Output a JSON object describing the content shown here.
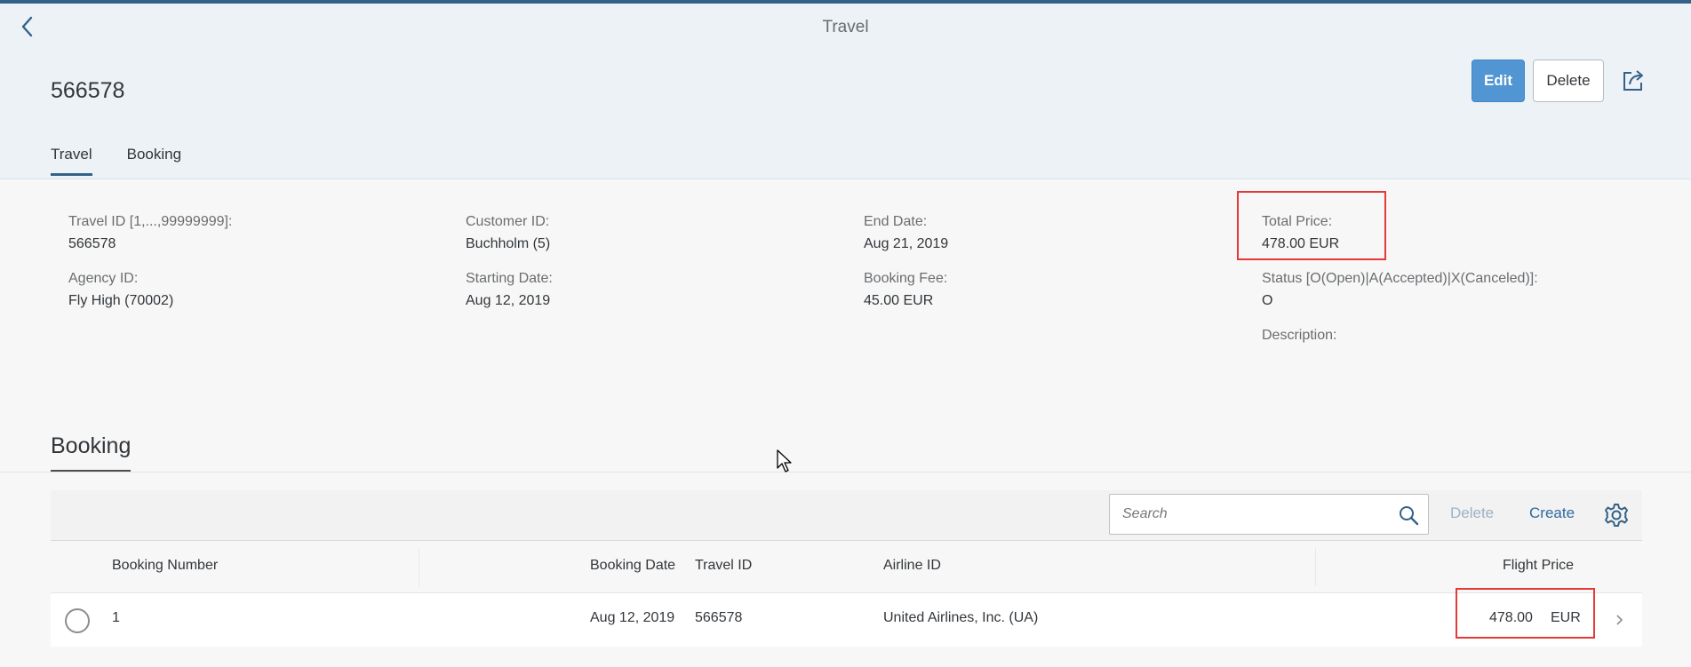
{
  "header": {
    "app_title": "Travel",
    "object_title": "566578",
    "edit_label": "Edit",
    "delete_label": "Delete",
    "tabs": [
      {
        "label": "Travel",
        "selected": true
      },
      {
        "label": "Booking",
        "selected": false
      }
    ]
  },
  "form": {
    "travel_id": {
      "label": "Travel ID [1,...,99999999]:",
      "value": "566578"
    },
    "agency_id": {
      "label": "Agency ID:",
      "value": "Fly High (70002)"
    },
    "customer_id": {
      "label": "Customer ID:",
      "value": "Buchholm (5)"
    },
    "starting_date": {
      "label": "Starting Date:",
      "value": "Aug 12, 2019"
    },
    "end_date": {
      "label": "End Date:",
      "value": "Aug 21, 2019"
    },
    "booking_fee": {
      "label": "Booking Fee:",
      "value": "45.00  EUR"
    },
    "total_price": {
      "label": "Total Price:",
      "value": "478.00  EUR"
    },
    "status": {
      "label": "Status [O(Open)|A(Accepted)|X(Canceled)]:",
      "value": "O"
    },
    "description": {
      "label": "Description:",
      "value": ""
    }
  },
  "booking": {
    "section_title": "Booking",
    "search_placeholder": "Search",
    "delete_label": "Delete",
    "create_label": "Create",
    "columns": [
      "Booking Number",
      "Booking Date",
      "Travel ID",
      "Airline ID",
      "Flight Price"
    ],
    "rows": [
      {
        "booking_number": "1",
        "booking_date": "Aug 12, 2019",
        "travel_id": "566578",
        "airline_id": "United Airlines, Inc. (UA)",
        "flight_price": "478.00",
        "currency": "EUR"
      }
    ]
  },
  "colors": {
    "accent": "#346187",
    "emphasized_button": "#5295d3",
    "highlight": "#e53935"
  },
  "icons": [
    "back-icon",
    "share-icon",
    "search-icon",
    "gear-icon",
    "chevron-right-icon",
    "mouse-cursor-icon"
  ]
}
